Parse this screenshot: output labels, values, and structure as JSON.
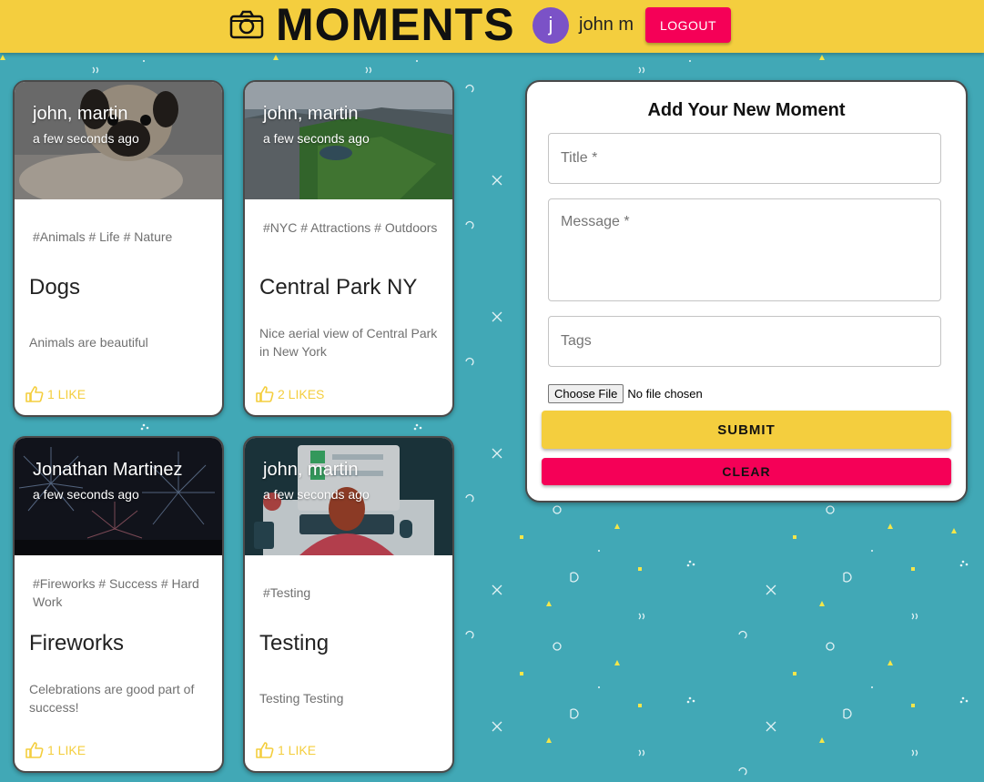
{
  "header": {
    "app_title": "MOMENTS",
    "logo_icon": "camera-icon",
    "user": {
      "avatar_initial": "j",
      "name": "john m",
      "avatar_color": "#7b52c7"
    },
    "logout_label": "LOGOUT"
  },
  "colors": {
    "accent_yellow": "#f4ce3e",
    "accent_pink": "#f50057",
    "background_teal": "#41a8b6"
  },
  "posts": [
    {
      "author": "john, martin",
      "time": "a few seconds ago",
      "tags": "#Animals # Life # Nature",
      "title": "Dogs",
      "message": "Animals are beautiful",
      "likes": "1 LIKE",
      "image": "pug-dog-photo"
    },
    {
      "author": "john, martin",
      "time": "a few seconds ago",
      "tags": "#NYC # Attractions # Outdoors",
      "title": "Central Park NY",
      "message": "Nice aerial view of Central Park in New York",
      "likes": "2 LIKES",
      "image": "central-park-aerial-photo"
    },
    {
      "author": "Jonathan Martinez",
      "time": "a few seconds ago",
      "tags": "#Fireworks # Success # Hard Work",
      "title": "Fireworks",
      "message": "Celebrations are good part of success!",
      "likes": "1 LIKE",
      "image": "fireworks-photo"
    },
    {
      "author": "john, martin",
      "time": "a few seconds ago",
      "tags": "#Testing",
      "title": "Testing",
      "message": "Testing Testing",
      "likes": "1 LIKE",
      "image": "person-at-computer-illustration"
    }
  ],
  "form": {
    "heading": "Add Your New Moment",
    "title_placeholder": "Title *",
    "message_placeholder": "Message *",
    "tags_placeholder": "Tags",
    "file_button": "Choose File",
    "file_status": "No file chosen",
    "submit_label": "SUBMIT",
    "clear_label": "CLEAR"
  }
}
